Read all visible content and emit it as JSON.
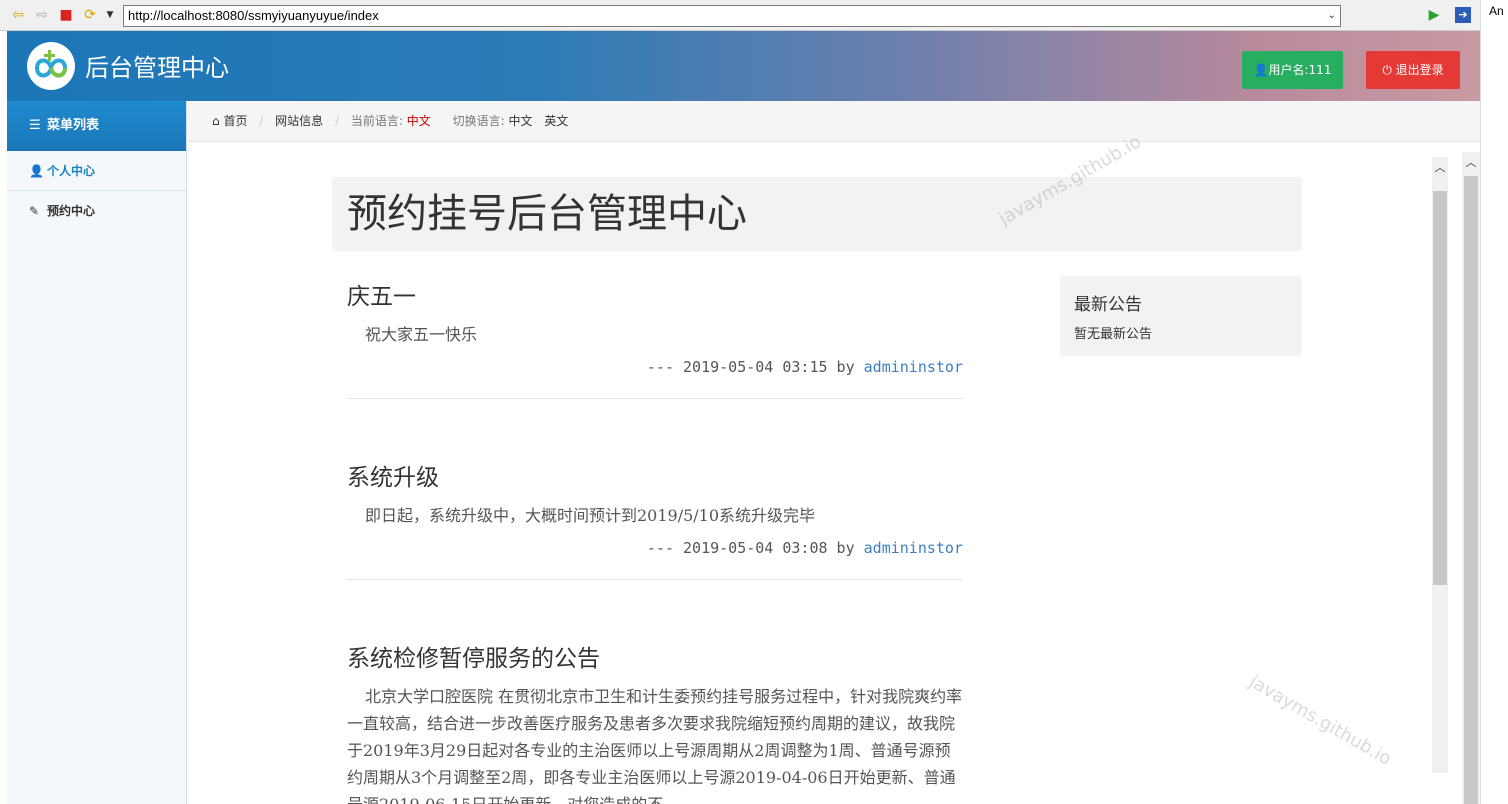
{
  "browser": {
    "url": "http://localhost:8080/ssmyiyuanyuyue/index",
    "corner_text": "An"
  },
  "header": {
    "brand": "后台管理中心",
    "user_button": "用户名:111",
    "logout_button": "退出登录"
  },
  "sidebar": {
    "title": "菜单列表",
    "items": [
      {
        "label": "个人中心"
      },
      {
        "label": "预约中心"
      }
    ]
  },
  "breadcrumb": {
    "home": "首页",
    "site_info": "网站信息",
    "current_lang_label": "当前语言:",
    "current_lang": "中文",
    "switch_lang_label": "切换语言:",
    "lang_zh": "中文",
    "lang_en": "英文"
  },
  "main": {
    "title": "预约挂号后台管理中心",
    "posts": [
      {
        "title": "庆五一",
        "body": "祝大家五一快乐",
        "meta_prefix": "--- 2019-05-04 03:15 by ",
        "author": "admininstor"
      },
      {
        "title": "系统升级",
        "body": "即日起，系统升级中，大概时间预计到2019/5/10系统升级完毕",
        "meta_prefix": "--- 2019-05-04 03:08 by ",
        "author": "admininstor"
      },
      {
        "title": "系统检修暂停服务的公告",
        "body": "北京大学口腔医院 在贯彻北京市卫生和计生委预约挂号服务过程中，针对我院爽约率一直较高，结合进一步改善医疗服务及患者多次要求我院缩短预约周期的建议，故我院于2019年3月29日起对各专业的主治医师以上号源周期从2周调整为1周、普通号源预约周期从3个月调整至2周，即各专业主治医师以上号源2019-04-06日开始更新、普通号源2019-06-15日开始更新。对您造成的不"
      }
    ],
    "notice": {
      "title": "最新公告",
      "text": "暂无最新公告"
    }
  },
  "watermark": "javayms.github.io",
  "colors": {
    "user_button": "#27ae60",
    "logout_button": "#e53935",
    "accent": "#1a82c4"
  }
}
